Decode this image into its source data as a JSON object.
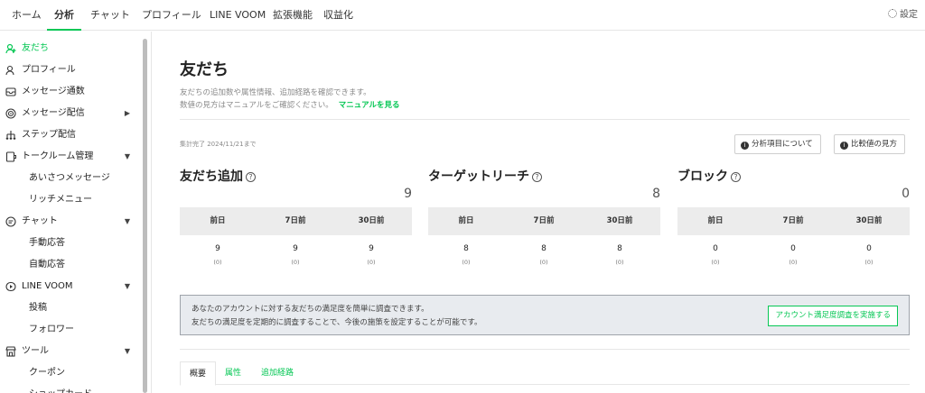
{
  "topnav": {
    "tabs": [
      "ホーム",
      "分析",
      "チャット",
      "プロフィール",
      "LINE VOOM",
      "拡張機能",
      "収益化"
    ],
    "active_index": 1,
    "settings_label": "設定"
  },
  "sidebar": {
    "items": [
      {
        "label": "友だち",
        "icon": "friend-icon",
        "active": true
      },
      {
        "label": "プロフィール",
        "icon": "profile-icon"
      },
      {
        "label": "メッセージ通数",
        "icon": "inbox-icon"
      },
      {
        "label": "メッセージ配信",
        "icon": "broadcast-icon",
        "caret": "▶"
      },
      {
        "label": "ステップ配信",
        "icon": "step-icon"
      },
      {
        "label": "トークルーム管理",
        "icon": "talkroom-icon",
        "caret": "▼"
      },
      {
        "label": "あいさつメッセージ",
        "sub": true
      },
      {
        "label": "リッチメニュー",
        "sub": true
      },
      {
        "label": "チャット",
        "icon": "chat-icon",
        "caret": "▼"
      },
      {
        "label": "手動応答",
        "sub": true
      },
      {
        "label": "自動応答",
        "sub": true
      },
      {
        "label": "LINE VOOM",
        "icon": "voom-icon",
        "caret": "▼"
      },
      {
        "label": "投稿",
        "sub": true
      },
      {
        "label": "フォロワー",
        "sub": true
      },
      {
        "label": "ツール",
        "icon": "tool-icon",
        "caret": "▼"
      },
      {
        "label": "クーポン",
        "sub": true
      },
      {
        "label": "ショップカード",
        "sub": true
      }
    ]
  },
  "main": {
    "title": "友だち",
    "desc_line1": "友だちの追加数や属性情報、追加経路を確認できます。",
    "desc_line2": "数値の見方はマニュアルをご確認ください。",
    "manual_link": "マニュアルを見る",
    "as_of": "集計完了 2024/11/21まで",
    "btn_about": "分析項目について",
    "btn_compare": "比較値の見方",
    "metrics": [
      {
        "title": "友だち追加",
        "value": "9",
        "headers": [
          "前日",
          "7日前",
          "30日前"
        ],
        "values": [
          "9",
          "9",
          "9"
        ],
        "diffs": [
          "(0)",
          "(0)",
          "(0)"
        ]
      },
      {
        "title": "ターゲットリーチ",
        "value": "8",
        "headers": [
          "前日",
          "7日前",
          "30日前"
        ],
        "values": [
          "8",
          "8",
          "8"
        ],
        "diffs": [
          "(0)",
          "(0)",
          "(0)"
        ]
      },
      {
        "title": "ブロック",
        "value": "0",
        "headers": [
          "前日",
          "7日前",
          "30日前"
        ],
        "values": [
          "0",
          "0",
          "0"
        ],
        "diffs": [
          "(0)",
          "(0)",
          "(0)"
        ]
      }
    ],
    "notice_line1": "あなたのアカウントに対する友だちの満足度を簡単に調査できます。",
    "notice_line2": "友だちの満足度を定期的に調査することで、今後の施策を設定することが可能です。",
    "notice_cta": "アカウント満足度調査を実施する",
    "subtabs": [
      "概要",
      "属性",
      "追加経路"
    ],
    "subtab_active": 0
  },
  "colors": {
    "accent": "#06c755"
  }
}
